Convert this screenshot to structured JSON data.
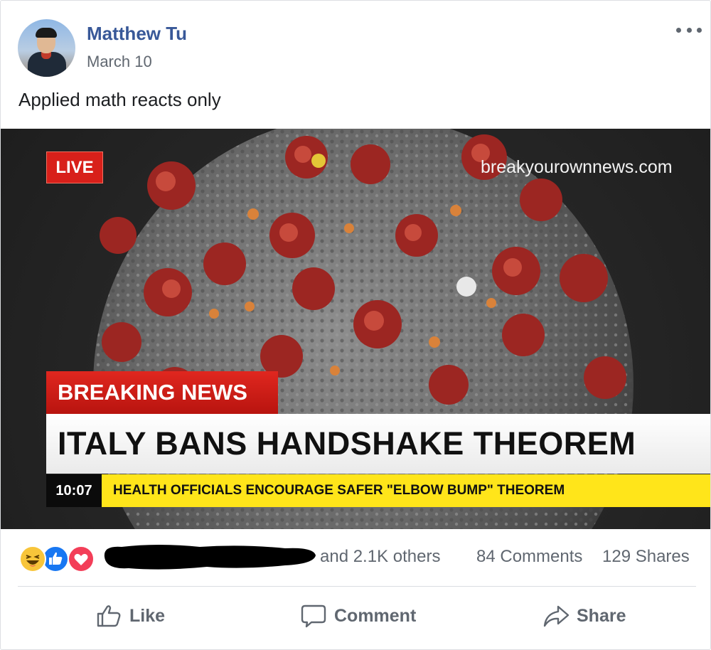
{
  "post": {
    "author": "Matthew Tu",
    "date": "March 10",
    "caption": "Applied math reacts only"
  },
  "media": {
    "live_badge": "LIVE",
    "site": "breakyourownnews.com",
    "breaking_label": "BREAKING NEWS",
    "headline": "ITALY BANS HANDSHAKE THEOREM",
    "ticker_time": "10:07",
    "ticker_text": "HEALTH OFFICIALS ENCOURAGE SAFER \"ELBOW BUMP\" THEOREM"
  },
  "stats": {
    "reaction_types": [
      "haha-icon",
      "like-icon",
      "love-icon"
    ],
    "others": "and 2.1K others",
    "comments": "84 Comments",
    "shares": "129 Shares"
  },
  "actions": {
    "like": "Like",
    "comment": "Comment",
    "share": "Share"
  },
  "colors": {
    "author_link": "#385898",
    "secondary_text": "#606770",
    "live_red": "#d8201a",
    "ticker_yellow": "#ffe51a",
    "like_blue": "#1877f2",
    "love_red": "#f33e58",
    "haha_yellow": "#f8c53a"
  }
}
